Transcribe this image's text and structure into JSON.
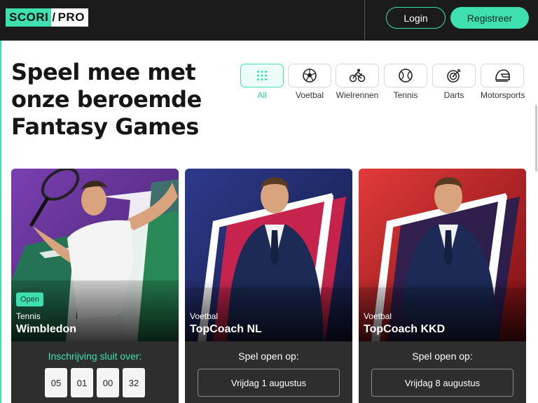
{
  "header": {
    "logo_left": "SCORI",
    "logo_slash": "/",
    "logo_right": "PRO",
    "login_label": "Login",
    "register_label": "Registreer"
  },
  "hero": {
    "line1": "Speel mee met",
    "line2": "onze beroemde",
    "line3": "Fantasy Games"
  },
  "filters": [
    {
      "label": "All",
      "icon": "grid-icon",
      "active": true
    },
    {
      "label": "Voetbal",
      "icon": "soccer-ball-icon"
    },
    {
      "label": "Wielrennen",
      "icon": "cyclist-icon"
    },
    {
      "label": "Tennis",
      "icon": "tennis-ball-icon"
    },
    {
      "label": "Darts",
      "icon": "dartboard-icon"
    },
    {
      "label": "Motorsports",
      "icon": "helmet-icon"
    }
  ],
  "cards": [
    {
      "badge": "Open",
      "sport": "Tennis",
      "title": "Wimbledon",
      "footer_label": "Inschrijving sluit over:",
      "countdown": [
        "05",
        "01",
        "00",
        "32"
      ]
    },
    {
      "sport": "Voetbal",
      "title": "TopCoach NL",
      "footer_label": "Spel open op:",
      "date_button": "Vrijdag 1 augustus"
    },
    {
      "sport": "Voetbal",
      "title": "TopCoach KKD",
      "footer_label": "Spel open op:",
      "date_button": "Vrijdag 8 augustus"
    }
  ],
  "colors": {
    "accent": "#3ee0b0",
    "header_bg": "#1b1b1b",
    "card_footer_bg": "#2e2e2e"
  }
}
